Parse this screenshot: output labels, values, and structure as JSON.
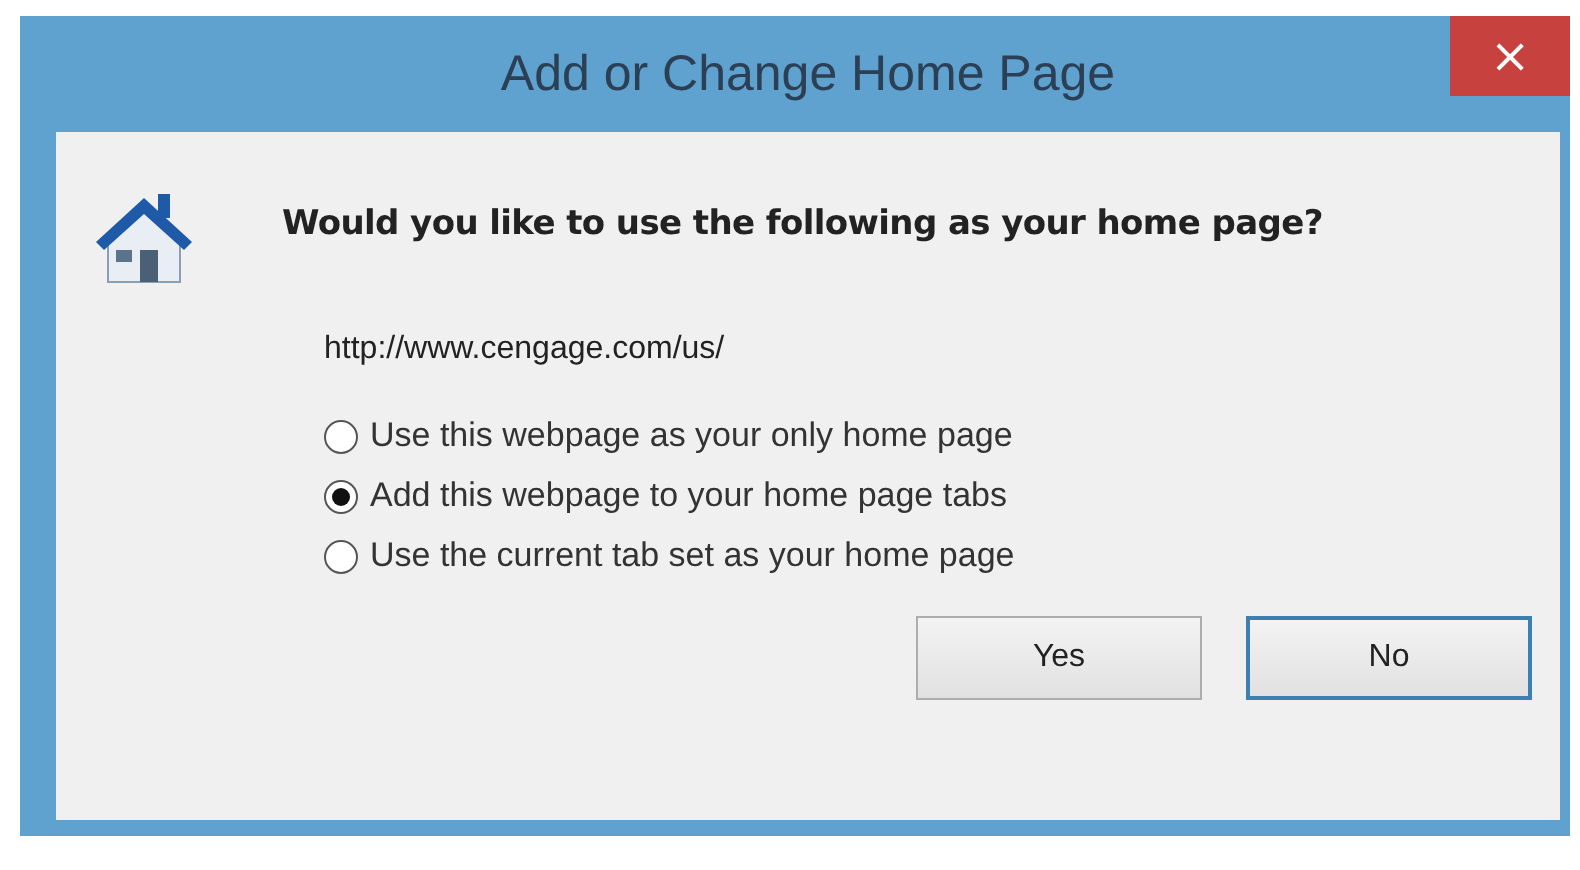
{
  "window": {
    "title": "Add or Change Home Page",
    "close": "×"
  },
  "question": "Would you like to use the following as your home page?",
  "url": "http://www.cengage.com/us/",
  "options": [
    {
      "label": "Use this webpage as your only home page",
      "selected": false
    },
    {
      "label": "Add this webpage to your home page tabs",
      "selected": true
    },
    {
      "label": "Use the current tab set as your home page",
      "selected": false
    }
  ],
  "buttons": [
    {
      "label": "Yes",
      "focused": false
    },
    {
      "label": "No",
      "focused": true
    }
  ]
}
